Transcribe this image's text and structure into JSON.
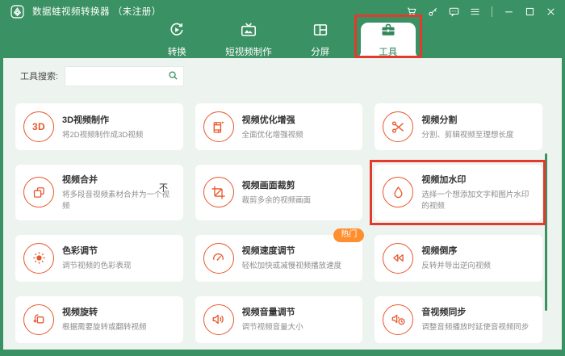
{
  "colors": {
    "brand_green": "#3A9163",
    "content_bg": "#EDF3EF",
    "card_bg": "#FFFFFF",
    "icon_orange": "#E8572B",
    "hot_badge_orange": "#FF8E2E",
    "annotation_red": "#E23A2C"
  },
  "titlebar": {
    "app_title": "数据蛙视频转换器",
    "register_status": "（未注册）"
  },
  "tabs": [
    {
      "id": "convert",
      "label": "转换",
      "active": false,
      "annotated": false
    },
    {
      "id": "short-video",
      "label": "短视频制作",
      "active": false,
      "annotated": false
    },
    {
      "id": "split-screen",
      "label": "分屏",
      "active": false,
      "annotated": false
    },
    {
      "id": "tools",
      "label": "工具",
      "active": true,
      "annotated": true
    }
  ],
  "search": {
    "label": "工具搜索:",
    "value": ""
  },
  "tools": [
    {
      "icon": "tool-3d",
      "title": "3D视频制作",
      "desc": "将2D视频制作成3D视频"
    },
    {
      "icon": "enhance",
      "title": "视频优化增强",
      "desc": "全面优化增强视频"
    },
    {
      "icon": "scissors",
      "title": "视频分割",
      "desc": "分割、剪辑视频至理想长度"
    },
    {
      "icon": "merge",
      "title": "视频合并",
      "desc": "将多段音视频素材合并为一个视频"
    },
    {
      "icon": "crop",
      "title": "视频画面裁剪",
      "desc": "裁剪多余的视频画面"
    },
    {
      "icon": "watermark",
      "title": "视频加水印",
      "desc": "选择一个想添加文字和图片水印的视频",
      "annotated": true
    },
    {
      "icon": "color",
      "title": "色彩调节",
      "desc": "调节视频的色彩表现"
    },
    {
      "icon": "speed",
      "title": "视频速度调节",
      "desc": "轻松加快或减慢视频播放速度",
      "badge": "热门"
    },
    {
      "icon": "reverse",
      "title": "视频倒序",
      "desc": "反转并导出逆向视频"
    },
    {
      "icon": "rotate",
      "title": "视频旋转",
      "desc": "根据需要旋转或翻转视频"
    },
    {
      "icon": "volume",
      "title": "视频音量调节",
      "desc": "调节视频音量大小"
    },
    {
      "icon": "audio-sync",
      "title": "音视频同步",
      "desc": "调整音频播放时延使音视频同步"
    }
  ],
  "stray_text": "不"
}
